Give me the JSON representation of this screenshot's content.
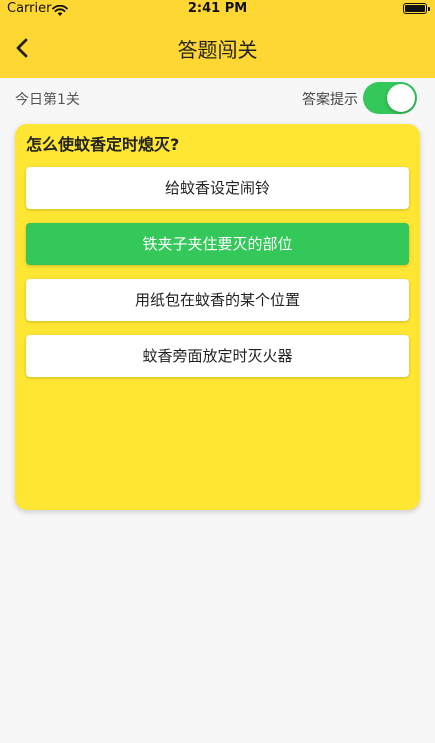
{
  "status_bar": {
    "carrier": "Carrier",
    "time": "2:41 PM"
  },
  "nav": {
    "title": "答题闯关",
    "back_icon": "chevron-left-icon"
  },
  "sub_header": {
    "level_text": "今日第1关",
    "hint_label": "答案提示",
    "hint_enabled": true
  },
  "quiz": {
    "question": "怎么使蚊香定时熄灭?",
    "options": [
      {
        "label": "给蚊香设定闹铃",
        "correct": false
      },
      {
        "label": "铁夹子夹住要灭的部位",
        "correct": true
      },
      {
        "label": "用纸包在蚊香的某个位置",
        "correct": false
      },
      {
        "label": "蚊香旁面放定时灭火器",
        "correct": false
      }
    ]
  },
  "colors": {
    "header_bg": "#ffd733",
    "card_bg": "#ffe633",
    "correct_bg": "#34c759",
    "toggle_on": "#34c759"
  }
}
